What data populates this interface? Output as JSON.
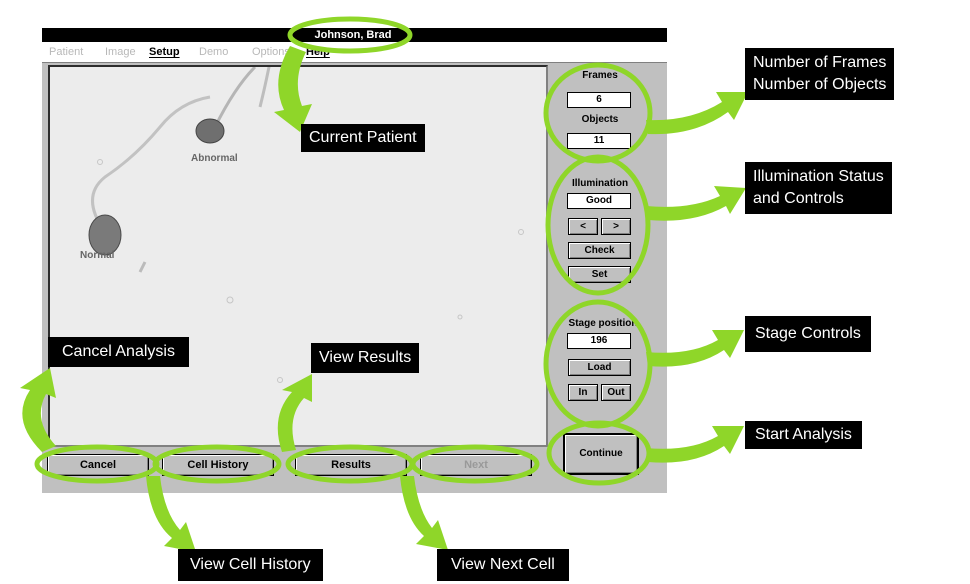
{
  "window": {
    "patient_name": "Johnson, Brad",
    "menu": [
      "Patient",
      "Image",
      "Setup",
      "Demo",
      "Options",
      "Help"
    ],
    "active_menu": "Setup"
  },
  "viewport": {
    "cells": [
      {
        "label": "Abnormal"
      },
      {
        "label": "Normal"
      }
    ]
  },
  "panel": {
    "frames_label": "Frames",
    "frames_value": "6",
    "objects_label": "Objects",
    "objects_value": "11",
    "illumination_label": "Illumination",
    "illumination_value": "Good",
    "illum_down": "<",
    "illum_up": ">",
    "check_label": "Check",
    "set_label": "Set",
    "stage_label": "Stage position",
    "stage_value": "196",
    "load_label": "Load",
    "in_label": "In",
    "out_label": "Out",
    "continue_label": "Continue"
  },
  "bottom": {
    "cancel": "Cancel",
    "cell_history": "Cell History",
    "results": "Results",
    "next": "Next"
  },
  "callouts": {
    "current_patient": "Current Patient",
    "frames_objects_1": "Number of Frames",
    "frames_objects_2": "Number of Objects",
    "illumination_1": "Illumination Status",
    "illumination_2": "and Controls",
    "stage": "Stage Controls",
    "start": "Start Analysis",
    "cancel": "Cancel Analysis",
    "view_results": "View Results",
    "cell_history": "View Cell History",
    "next_cell": "View Next Cell"
  },
  "colors": {
    "highlight": "#8fd629",
    "callout_bg": "#000000"
  }
}
